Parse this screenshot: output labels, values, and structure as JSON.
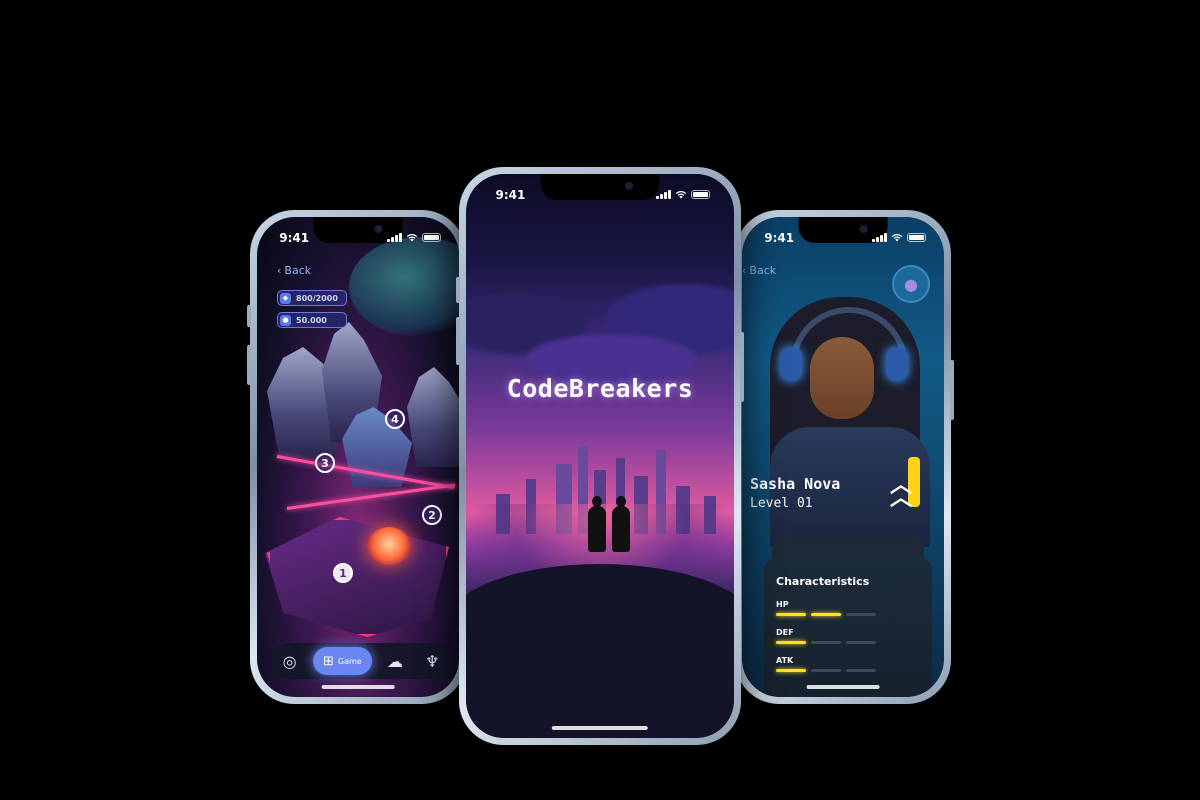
{
  "status_time": "9:41",
  "left_phone": {
    "back_label": "Back",
    "stats": [
      {
        "icon": "gem-icon",
        "value": "800/2000"
      },
      {
        "icon": "coin-icon",
        "value": "50.000"
      }
    ],
    "level_nodes": [
      "1",
      "2",
      "3",
      "4"
    ],
    "tabbar": {
      "items": [
        {
          "icon": "target-icon"
        },
        {
          "icon": "gamepad-icon",
          "label": "Game",
          "active": true
        },
        {
          "icon": "cloud-icon"
        },
        {
          "icon": "trophy-icon"
        }
      ]
    }
  },
  "center_phone": {
    "app_title": "CodeBreakers"
  },
  "right_phone": {
    "back_label": "Back",
    "character": {
      "name": "Sasha Nova",
      "level": "Level 01"
    },
    "characteristics_title": "Characteristics",
    "stats": [
      {
        "label": "HP",
        "filled": 2,
        "total": 3
      },
      {
        "label": "DEF",
        "filled": 1,
        "total": 3
      },
      {
        "label": "ATK",
        "filled": 1,
        "total": 3
      }
    ],
    "accent_color": "#ffe21a"
  }
}
